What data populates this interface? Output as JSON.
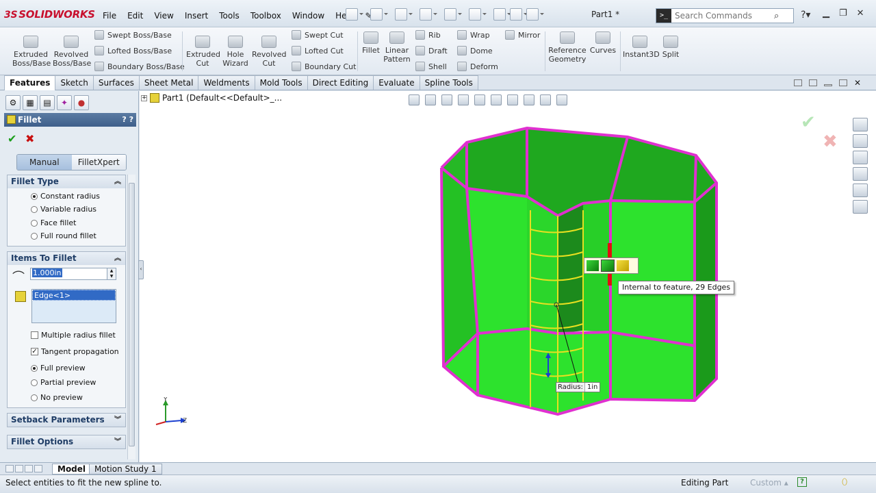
{
  "app": {
    "logo": "SOLIDWORKS",
    "logo_prefix": "3S",
    "doc_title": "Part1 *"
  },
  "menu": [
    "File",
    "Edit",
    "View",
    "Insert",
    "Tools",
    "Toolbox",
    "Window",
    "Help"
  ],
  "search": {
    "placeholder": "Search Commands"
  },
  "ribbon": {
    "extruded_boss": "Extruded\nBoss/Base",
    "revolved_boss": "Revolved\nBoss/Base",
    "swept_boss": "Swept Boss/Base",
    "lofted_boss": "Lofted Boss/Base",
    "boundary_boss": "Boundary Boss/Base",
    "extruded_cut": "Extruded\nCut",
    "hole_wizard": "Hole\nWizard",
    "revolved_cut": "Revolved\nCut",
    "swept_cut": "Swept Cut",
    "lofted_cut": "Lofted Cut",
    "boundary_cut": "Boundary Cut",
    "fillet": "Fillet",
    "linear_pattern": "Linear\nPattern",
    "rib": "Rib",
    "draft": "Draft",
    "shell": "Shell",
    "wrap": "Wrap",
    "dome": "Dome",
    "deform": "Deform",
    "mirror": "Mirror",
    "reference_geometry": "Reference\nGeometry",
    "curves": "Curves",
    "instant3d": "Instant3D",
    "split": "Split"
  },
  "cm_tabs": [
    "Features",
    "Sketch",
    "Surfaces",
    "Sheet Metal",
    "Weldments",
    "Mold Tools",
    "Direct Editing",
    "Evaluate",
    "Spline Tools"
  ],
  "pm": {
    "title": "Fillet",
    "help": "? ?",
    "mode_manual": "Manual",
    "mode_filletxpert": "FilletXpert",
    "fillet_type": {
      "heading": "Fillet Type",
      "options": [
        "Constant radius",
        "Variable radius",
        "Face fillet",
        "Full round fillet"
      ]
    },
    "items_to_fillet": {
      "heading": "Items To Fillet",
      "radius_value": "1.000in",
      "edge_item": "Edge<1>",
      "multiple_radius": "Multiple radius fillet",
      "tangent_propagation": "Tangent propagation",
      "full_preview": "Full preview",
      "partial_preview": "Partial preview",
      "no_preview": "No preview"
    },
    "setback_heading": "Setback Parameters",
    "options_heading": "Fillet Options"
  },
  "tree": {
    "label": "Part1  (Default<<Default>_..."
  },
  "viewport": {
    "tooltip": "Internal to feature, 29 Edges",
    "radius_label": "Radius:",
    "radius_value": "1in",
    "triad_y": "Y",
    "triad_z": "Z"
  },
  "bottom_tabs": [
    "Model",
    "Motion Study 1"
  ],
  "status": {
    "message": "Select entities to fit the new spline to.",
    "mode": "Editing Part",
    "units": "Custom",
    "help": "?"
  },
  "colors": {
    "face_green": "#2bd62b",
    "edge_magenta": "#e030d0",
    "accent_blue": "#3e5f8a"
  }
}
